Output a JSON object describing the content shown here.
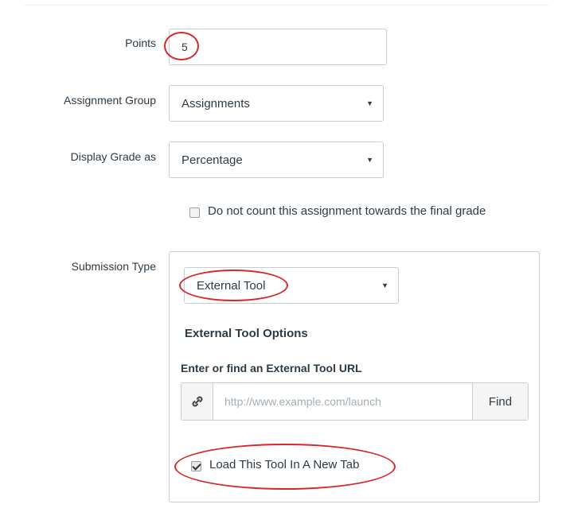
{
  "form": {
    "points": {
      "label": "Points",
      "value": "5"
    },
    "assignment_group": {
      "label": "Assignment Group",
      "selected": "Assignments"
    },
    "display_grade": {
      "label": "Display Grade as",
      "selected": "Percentage"
    },
    "omit_from_final": {
      "label": "Do not count this assignment towards the final grade",
      "checked": false
    },
    "submission_type": {
      "label": "Submission Type",
      "selected": "External Tool"
    }
  },
  "external_tool": {
    "heading": "External Tool Options",
    "url_label": "Enter or find an External Tool URL",
    "url_placeholder": "http://www.example.com/launch",
    "url_icon": "link-icon",
    "find_label": "Find",
    "new_tab": {
      "label": "Load This Tool In A New Tab",
      "checked": true
    }
  },
  "select_caret": "▼",
  "colors": {
    "annotation": "#d9252b",
    "border": "#c7cdd1",
    "text": "#2d3b45"
  }
}
